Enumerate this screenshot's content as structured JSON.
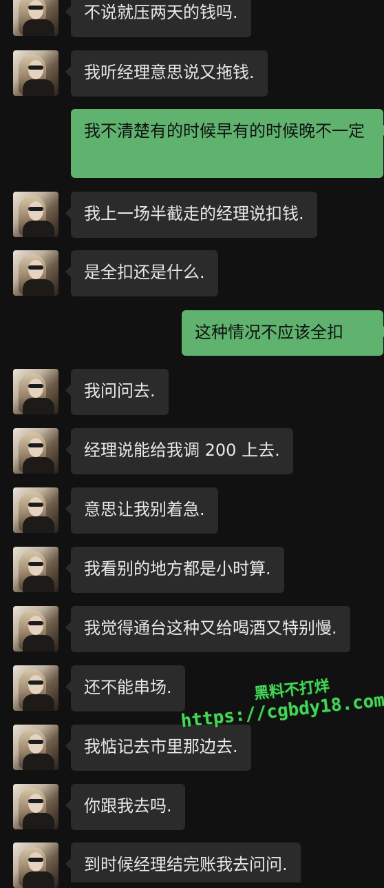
{
  "messages": [
    {
      "side": "in",
      "text": "不说就压两天的钱吗."
    },
    {
      "side": "in",
      "text": "我听经理意思说又拖钱."
    },
    {
      "side": "out",
      "text": "我不清楚有的时候早有的时候晚不一定"
    },
    {
      "side": "in",
      "text": "我上一场半截走的经理说扣钱."
    },
    {
      "side": "in",
      "text": "是全扣还是什么."
    },
    {
      "side": "out",
      "text": "这种情况不应该全扣"
    },
    {
      "side": "in",
      "text": "我问问去."
    },
    {
      "side": "in",
      "text": "经理说能给我调 200 上去."
    },
    {
      "side": "in",
      "text": "意思让我别着急."
    },
    {
      "side": "in",
      "text": "我看别的地方都是小时算."
    },
    {
      "side": "in",
      "text": "我觉得通台这种又给喝酒又特别慢."
    },
    {
      "side": "in",
      "text": "还不能串场."
    },
    {
      "side": "in",
      "text": "我惦记去市里那边去."
    },
    {
      "side": "in",
      "text": "你跟我去吗."
    },
    {
      "side": "in",
      "text": "到时候经理结完账我去问问."
    }
  ],
  "watermark": {
    "title": "黑料不打烊",
    "url": "https://cgbdy18.com"
  },
  "colors": {
    "background": "#111111",
    "incoming_bubble": "#2b2b2b",
    "outgoing_bubble": "#5fb36e",
    "watermark": "#48d35a"
  }
}
